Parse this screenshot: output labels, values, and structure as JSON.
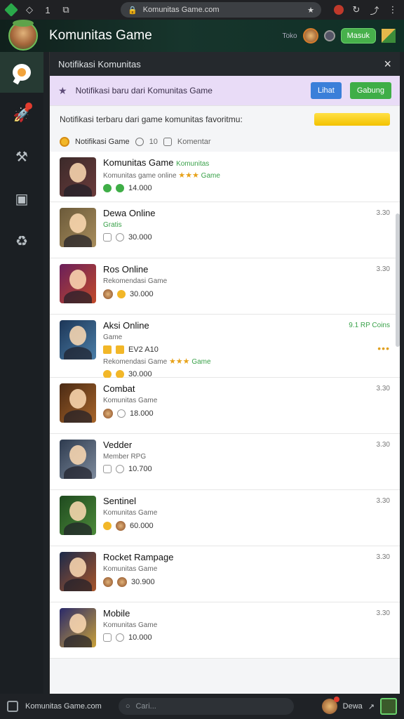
{
  "browser": {
    "tab_count": "1",
    "url": "Komunitas Game.com"
  },
  "header": {
    "title": "Komunitas Game",
    "small_label": "Toko",
    "button_label": "Masuk"
  },
  "panel": {
    "title": "Notifikasi Komunitas",
    "close": "×",
    "promo_text": "Notifikasi baru dari Komunitas Game",
    "promo_btn_blue": "Lihat",
    "promo_btn_green": "Gabung",
    "notice_text": "Notifikasi terbaru dari game komunitas favoritmu:",
    "filters": {
      "label": "Notifikasi Game",
      "count": "10",
      "filter2": "Komentar"
    }
  },
  "rows": [
    {
      "name": "Komunitas Game",
      "badge": "Komunitas",
      "sub": "Komunitas game online",
      "rating": "★★★",
      "tag": "Game",
      "stat": "14.000",
      "time": ""
    },
    {
      "name": "Dewa Online",
      "sub": "Gratis",
      "stat": "30.000",
      "time": "3.30"
    },
    {
      "name": "Ros Online",
      "sub": "Rekomendasi Game",
      "stat": "30.000",
      "time": "3.30"
    },
    {
      "name": "Aksi Online",
      "sub": "Game",
      "extra": "EV2 A10",
      "sub2": "Rekomendasi Game",
      "rating": "★★★",
      "tag": "Game",
      "stat": "30.000",
      "time": "9.1 RP Coins"
    },
    {
      "name": "Combat",
      "sub": "Komunitas Game",
      "stat": "18.000",
      "time": "3.30"
    },
    {
      "name": "Vedder",
      "sub": "Member RPG",
      "stat": "10.700",
      "time": "3.30"
    },
    {
      "name": "Sentinel",
      "sub": "Komunitas Game",
      "stat": "60.000",
      "time": "3.30"
    },
    {
      "name": "Rocket Rampage",
      "sub": "Komunitas Game",
      "stat": "30.900",
      "time": "3.30"
    },
    {
      "name": "Mobile",
      "sub": "Komunitas Game",
      "stat": "10.000",
      "time": "3.30"
    }
  ],
  "bottombar": {
    "left_label": "Komunitas Game.com",
    "search_placeholder": "Cari...",
    "right_label": "Dewa"
  },
  "colors": {
    "accent_green": "#3fae47",
    "promo_bg": "#e9dcf7",
    "header_bg": "#17352c"
  }
}
